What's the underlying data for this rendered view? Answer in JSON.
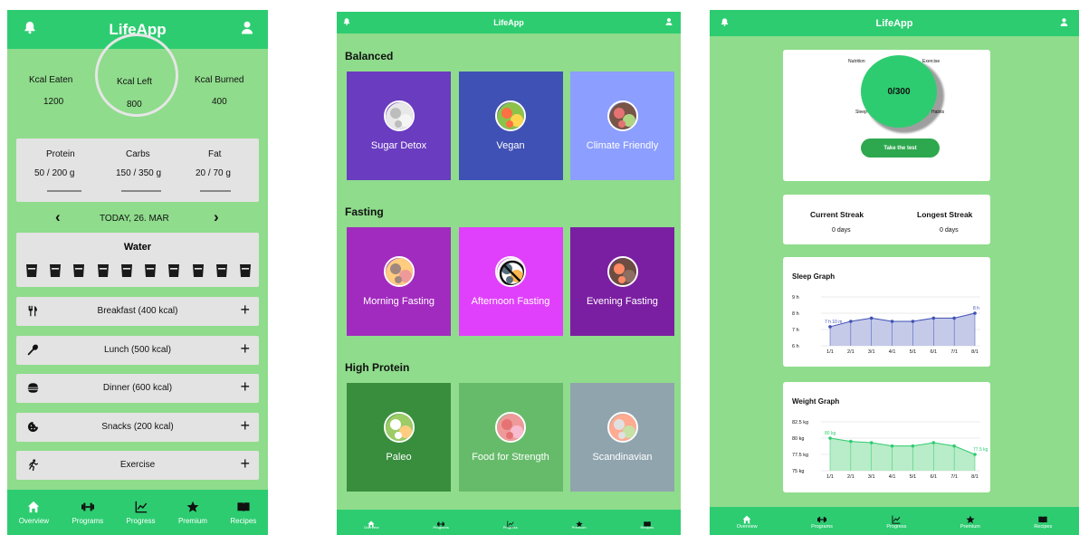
{
  "app_title": "LifeApp",
  "screen1": {
    "kcal": {
      "eaten_label": "Kcal Eaten",
      "eaten_value": "1200",
      "left_label": "Kcal Left",
      "left_value": "800",
      "burned_label": "Kcal Burned",
      "burned_value": "400"
    },
    "macros": [
      {
        "label": "Protein",
        "value": "50 / 200 g"
      },
      {
        "label": "Carbs",
        "value": "150 / 350 g"
      },
      {
        "label": "Fat",
        "value": "20 / 70 g"
      }
    ],
    "date_label": "TODAY, 26. MAR",
    "prev_arrow": "‹",
    "next_arrow": "›",
    "water_title": "Water",
    "water_glasses": 10,
    "meals": [
      {
        "icon": "cutlery-icon",
        "label": "Breakfast (400 kcal)"
      },
      {
        "icon": "spoon-icon",
        "label": "Lunch (500 kcal)"
      },
      {
        "icon": "burger-icon",
        "label": "Dinner (600 kcal)"
      },
      {
        "icon": "cookie-icon",
        "label": "Snacks (200 kcal)"
      },
      {
        "icon": "runner-icon",
        "label": "Exercise"
      }
    ],
    "add_symbol": "+"
  },
  "nav": [
    {
      "icon": "home-icon",
      "label": "Overview"
    },
    {
      "icon": "dumbbell-icon",
      "label": "Programs"
    },
    {
      "icon": "chart-icon",
      "label": "Progress"
    },
    {
      "icon": "star-icon",
      "label": "Premium"
    },
    {
      "icon": "book-icon",
      "label": "Recipes"
    }
  ],
  "screen2": {
    "sections": [
      {
        "title": "Balanced",
        "items": [
          {
            "label": "Sugar Detox",
            "color": "#6a3cc0"
          },
          {
            "label": "Vegan",
            "color": "#3f51b5"
          },
          {
            "label": "Climate Friendly",
            "color": "#8c9eff"
          }
        ]
      },
      {
        "title": "Fasting",
        "items": [
          {
            "label": "Morning Fasting",
            "color": "#a22bbf"
          },
          {
            "label": "Afternoon Fasting",
            "color": "#e040fb"
          },
          {
            "label": "Evening Fasting",
            "color": "#7b1fa2"
          }
        ]
      },
      {
        "title": "High Protein",
        "items": [
          {
            "label": "Paleo",
            "color": "#388e3c"
          },
          {
            "label": "Food for Strength",
            "color": "#66bb6a"
          },
          {
            "label": "Scandinavian",
            "color": "#90a4ae"
          }
        ]
      }
    ]
  },
  "screen3": {
    "score": "0/300",
    "score_labels": [
      "Nutrition",
      "Exercise",
      "Sleep",
      "Habits"
    ],
    "test_button": "Take the test",
    "current_streak_label": "Current Streak",
    "current_streak_value": "0 days",
    "longest_streak_label": "Longest Streak",
    "longest_streak_value": "0 days",
    "sleep_title": "Sleep Graph",
    "weight_title": "Weight Graph"
  },
  "chart_data": [
    {
      "type": "area",
      "title": "Sleep Graph",
      "categories": [
        "1/1",
        "2/1",
        "3/1",
        "4/1",
        "5/1",
        "6/1",
        "7/1",
        "8/1"
      ],
      "values": [
        7.17,
        7.5,
        7.7,
        7.5,
        7.5,
        7.7,
        7.7,
        8
      ],
      "ytick_labels": [
        "9 h",
        "8 h",
        "7 h",
        "6 h"
      ],
      "yticks": [
        9,
        8,
        7,
        6
      ],
      "ylim": [
        6,
        9
      ],
      "data_labels": [
        {
          "index": 0,
          "text": "7 h 10 m"
        },
        {
          "index": 7,
          "text": "8 h"
        }
      ],
      "color": "#3f51b5",
      "fill": "#c5cae9",
      "grid": true
    },
    {
      "type": "area",
      "title": "Weight Graph",
      "categories": [
        "1/1",
        "2/1",
        "3/1",
        "4/1",
        "5/1",
        "6/1",
        "7/1",
        "8/1"
      ],
      "values": [
        80,
        79.5,
        79.3,
        78.8,
        78.8,
        79.3,
        78.8,
        77.5
      ],
      "ytick_labels": [
        "82.5 kg",
        "80 kg",
        "77.5 kg",
        "75 kg"
      ],
      "yticks": [
        82.5,
        80,
        77.5,
        75
      ],
      "ylim": [
        75,
        82.5
      ],
      "data_labels": [
        {
          "index": 0,
          "text": "80 kg"
        },
        {
          "index": 7,
          "text": "77.5 kg"
        }
      ],
      "color": "#2ecc71",
      "fill": "#b9ecc8",
      "grid": true
    }
  ]
}
